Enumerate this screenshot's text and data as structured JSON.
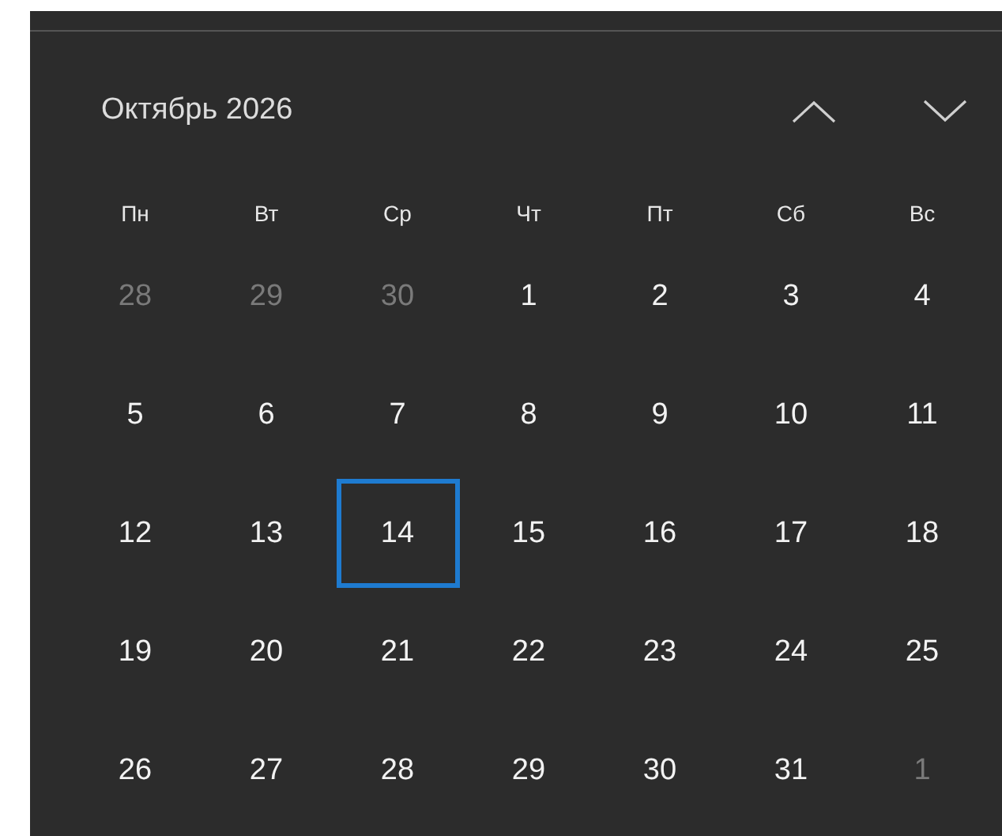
{
  "calendar": {
    "title": "Октябрь 2026",
    "weekdays": [
      "Пн",
      "Вт",
      "Ср",
      "Чт",
      "Пт",
      "Сб",
      "Вс"
    ],
    "days": [
      {
        "label": "28",
        "dimmed": true,
        "selected": false
      },
      {
        "label": "29",
        "dimmed": true,
        "selected": false
      },
      {
        "label": "30",
        "dimmed": true,
        "selected": false
      },
      {
        "label": "1",
        "dimmed": false,
        "selected": false
      },
      {
        "label": "2",
        "dimmed": false,
        "selected": false
      },
      {
        "label": "3",
        "dimmed": false,
        "selected": false
      },
      {
        "label": "4",
        "dimmed": false,
        "selected": false
      },
      {
        "label": "5",
        "dimmed": false,
        "selected": false
      },
      {
        "label": "6",
        "dimmed": false,
        "selected": false
      },
      {
        "label": "7",
        "dimmed": false,
        "selected": false
      },
      {
        "label": "8",
        "dimmed": false,
        "selected": false
      },
      {
        "label": "9",
        "dimmed": false,
        "selected": false
      },
      {
        "label": "10",
        "dimmed": false,
        "selected": false
      },
      {
        "label": "11",
        "dimmed": false,
        "selected": false
      },
      {
        "label": "12",
        "dimmed": false,
        "selected": false
      },
      {
        "label": "13",
        "dimmed": false,
        "selected": false
      },
      {
        "label": "14",
        "dimmed": false,
        "selected": true
      },
      {
        "label": "15",
        "dimmed": false,
        "selected": false
      },
      {
        "label": "16",
        "dimmed": false,
        "selected": false
      },
      {
        "label": "17",
        "dimmed": false,
        "selected": false
      },
      {
        "label": "18",
        "dimmed": false,
        "selected": false
      },
      {
        "label": "19",
        "dimmed": false,
        "selected": false
      },
      {
        "label": "20",
        "dimmed": false,
        "selected": false
      },
      {
        "label": "21",
        "dimmed": false,
        "selected": false
      },
      {
        "label": "22",
        "dimmed": false,
        "selected": false
      },
      {
        "label": "23",
        "dimmed": false,
        "selected": false
      },
      {
        "label": "24",
        "dimmed": false,
        "selected": false
      },
      {
        "label": "25",
        "dimmed": false,
        "selected": false
      },
      {
        "label": "26",
        "dimmed": false,
        "selected": false
      },
      {
        "label": "27",
        "dimmed": false,
        "selected": false
      },
      {
        "label": "28",
        "dimmed": false,
        "selected": false
      },
      {
        "label": "29",
        "dimmed": false,
        "selected": false
      },
      {
        "label": "30",
        "dimmed": false,
        "selected": false
      },
      {
        "label": "31",
        "dimmed": false,
        "selected": false
      },
      {
        "label": "1",
        "dimmed": true,
        "selected": false
      }
    ]
  }
}
